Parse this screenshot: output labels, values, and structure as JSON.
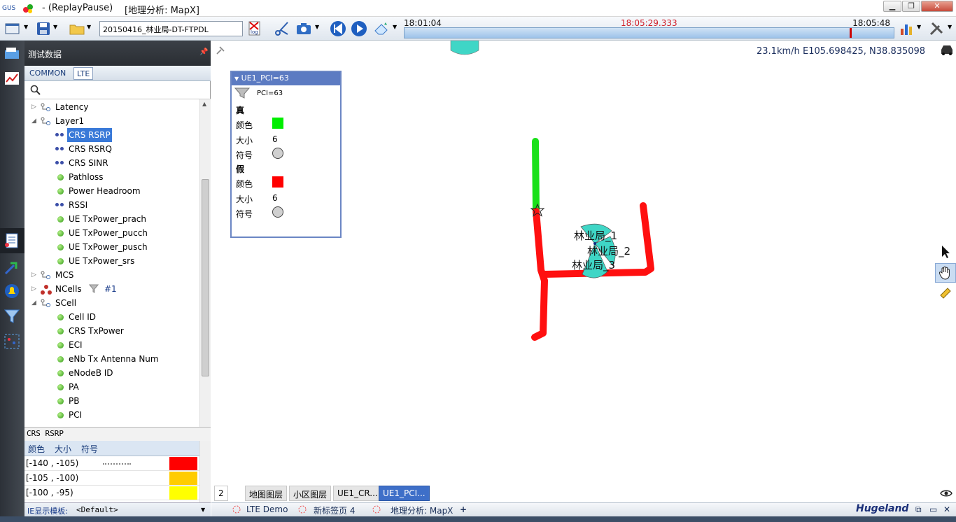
{
  "titlebar": {
    "app": "GUS",
    "replay": "- (ReplayPause)",
    "window": "[地理分析: MapX]"
  },
  "toolbar": {
    "file_combo": "20150416_林业局-DT-FTPDL",
    "time_start": "18:01:04",
    "time_current": "18:05:29.333",
    "time_end": "18:05:48",
    "time_color": "#d0202a",
    "progress": 0.91
  },
  "panel": {
    "title": "测试数据",
    "tabs": [
      "COMMON",
      "LTE"
    ],
    "tree": [
      {
        "label": "Latency",
        "type": "group",
        "expanded": false,
        "indent": 0
      },
      {
        "label": "Layer1",
        "type": "group",
        "expanded": true,
        "indent": 0
      },
      {
        "label": "CRS RSRP",
        "type": "blue",
        "indent": 1,
        "selected": true
      },
      {
        "label": "CRS RSRQ",
        "type": "blue",
        "indent": 1
      },
      {
        "label": "CRS SINR",
        "type": "blue",
        "indent": 1
      },
      {
        "label": "Pathloss",
        "type": "green",
        "indent": 1
      },
      {
        "label": "Power Headroom",
        "type": "green",
        "indent": 1
      },
      {
        "label": "RSSI",
        "type": "blue",
        "indent": 1
      },
      {
        "label": "UE TxPower_prach",
        "type": "green",
        "indent": 1
      },
      {
        "label": "UE TxPower_pucch",
        "type": "green",
        "indent": 1
      },
      {
        "label": "UE TxPower_pusch",
        "type": "green",
        "indent": 1
      },
      {
        "label": "UE TxPower_srs",
        "type": "green",
        "indent": 1
      },
      {
        "label": "MCS",
        "type": "group",
        "expanded": false,
        "indent": 0
      },
      {
        "label": "NCells",
        "type": "ncells",
        "expanded": false,
        "indent": 0,
        "extra": "#1"
      },
      {
        "label": "SCell",
        "type": "group",
        "expanded": true,
        "indent": 0
      },
      {
        "label": "Cell ID",
        "type": "green",
        "indent": 1
      },
      {
        "label": "CRS TxPower",
        "type": "green",
        "indent": 1
      },
      {
        "label": "ECI",
        "type": "green",
        "indent": 1
      },
      {
        "label": "eNb Tx Antenna Num",
        "type": "green",
        "indent": 1
      },
      {
        "label": "eNodeB ID",
        "type": "green",
        "indent": 1
      },
      {
        "label": "PA",
        "type": "green",
        "indent": 1
      },
      {
        "label": "PB",
        "type": "green",
        "indent": 1
      },
      {
        "label": "PCI",
        "type": "green",
        "indent": 1
      }
    ],
    "legend_title": "CRS RSRP",
    "legend_tabs": [
      "颜色",
      "大小",
      "符号"
    ],
    "legend_rows": [
      {
        "range": "[-140 , -105)",
        "color": "#ff0000"
      },
      {
        "range": "[-105 , -100)",
        "color": "#ffcc00"
      },
      {
        "range": "[-100 , -95)",
        "color": "#ffff00"
      }
    ],
    "ie_label": "IE显示模板:",
    "ie_value": "<Default>"
  },
  "map": {
    "speed": "23.1km/h",
    "coords": "E105.698425, N38.835098",
    "legend": {
      "title": "UE1_PCI=63",
      "filter": "PCI=63",
      "true_label": "真",
      "false_label": "假",
      "color_label": "颜色",
      "size_label": "大小",
      "symbol_label": "符号",
      "true_color": "#00ee00",
      "false_color": "#ff0000",
      "true_size": "6",
      "false_size": "6"
    },
    "cells": [
      "林业局_1",
      "林业局_2",
      "林业局_3"
    ],
    "page_num": "2",
    "bottom_tabs": [
      "地图图层",
      "小区图层",
      "UE1_CR...",
      "UE1_PCI..."
    ]
  },
  "docbar": {
    "tabs": [
      "LTE Demo",
      "新标签页 4",
      "地理分析: MapX"
    ],
    "brand": "Hugeland"
  }
}
